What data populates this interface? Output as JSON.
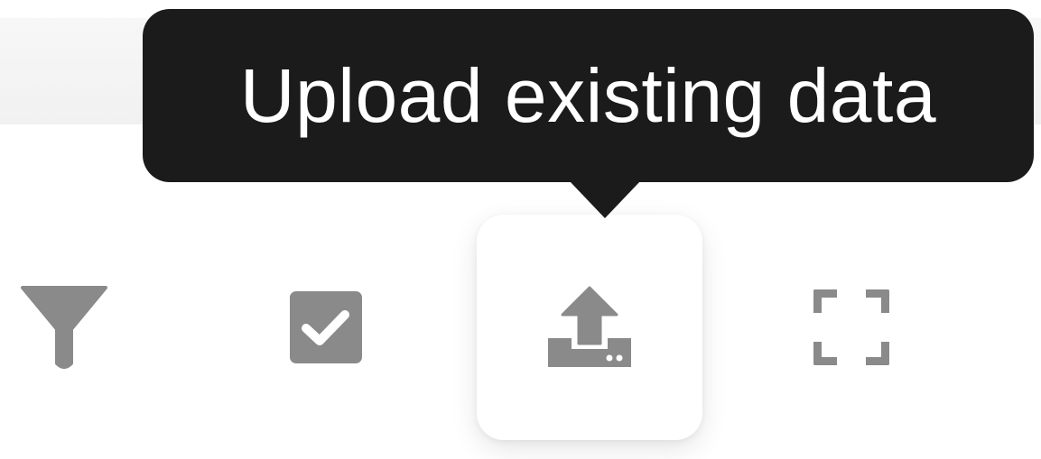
{
  "toolbar": {
    "buttons": [
      {
        "icon": "filter-icon",
        "label": "Filter"
      },
      {
        "icon": "checkbox-checked-icon",
        "label": "Select"
      },
      {
        "icon": "upload-icon",
        "label": "Upload existing data",
        "active": true
      },
      {
        "icon": "fullscreen-icon",
        "label": "Fullscreen"
      }
    ],
    "icon_color": "#8a8a8a"
  },
  "tooltip": {
    "text": "Upload existing data",
    "background": "#1b1b1b",
    "text_color": "#ffffff"
  }
}
